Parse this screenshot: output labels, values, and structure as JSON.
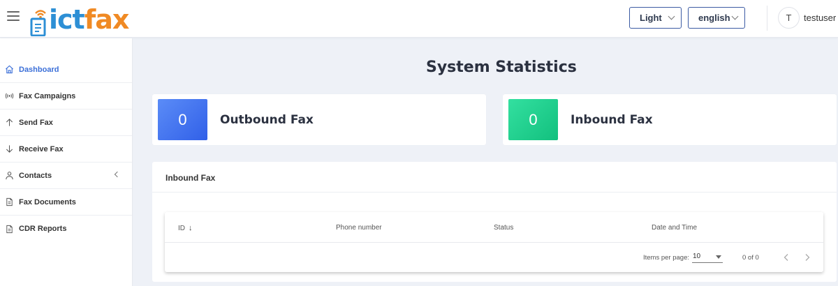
{
  "header": {
    "logo": {
      "part1": "ict",
      "part2": "fax"
    },
    "theme_select": "Light",
    "language_select": "english",
    "user": {
      "initial": "T",
      "name": "testuser"
    }
  },
  "sidebar": {
    "items": [
      {
        "label": "Dashboard",
        "icon": "home-icon",
        "active": true
      },
      {
        "label": "Fax Campaigns",
        "icon": "broadcast-icon"
      },
      {
        "label": "Send Fax",
        "icon": "arrow-up-icon"
      },
      {
        "label": "Receive Fax",
        "icon": "arrow-down-icon"
      },
      {
        "label": "Contacts",
        "icon": "person-icon",
        "has_submenu": true
      },
      {
        "label": "Fax Documents",
        "icon": "document-icon"
      },
      {
        "label": "CDR Reports",
        "icon": "document-icon"
      }
    ]
  },
  "main": {
    "title": "System Statistics",
    "stats": {
      "outbound": {
        "value": "0",
        "label": "Outbound Fax"
      },
      "inbound": {
        "value": "0",
        "label": "Inbound Fax"
      }
    },
    "panel": {
      "title": "Inbound Fax",
      "table": {
        "columns": [
          "ID",
          "Phone number",
          "Status",
          "Date and Time"
        ],
        "sort_indicator": "↓",
        "rows": []
      },
      "paginator": {
        "items_per_page_label": "Items per page:",
        "page_size": "10",
        "range": "0 of 0"
      }
    }
  },
  "colors": {
    "accent": "#3b6fd8",
    "logo_blue": "#2d8fd5",
    "logo_orange": "#f08a24",
    "outbound_box": "#3f6ff0",
    "inbound_box": "#1fcf8c"
  }
}
